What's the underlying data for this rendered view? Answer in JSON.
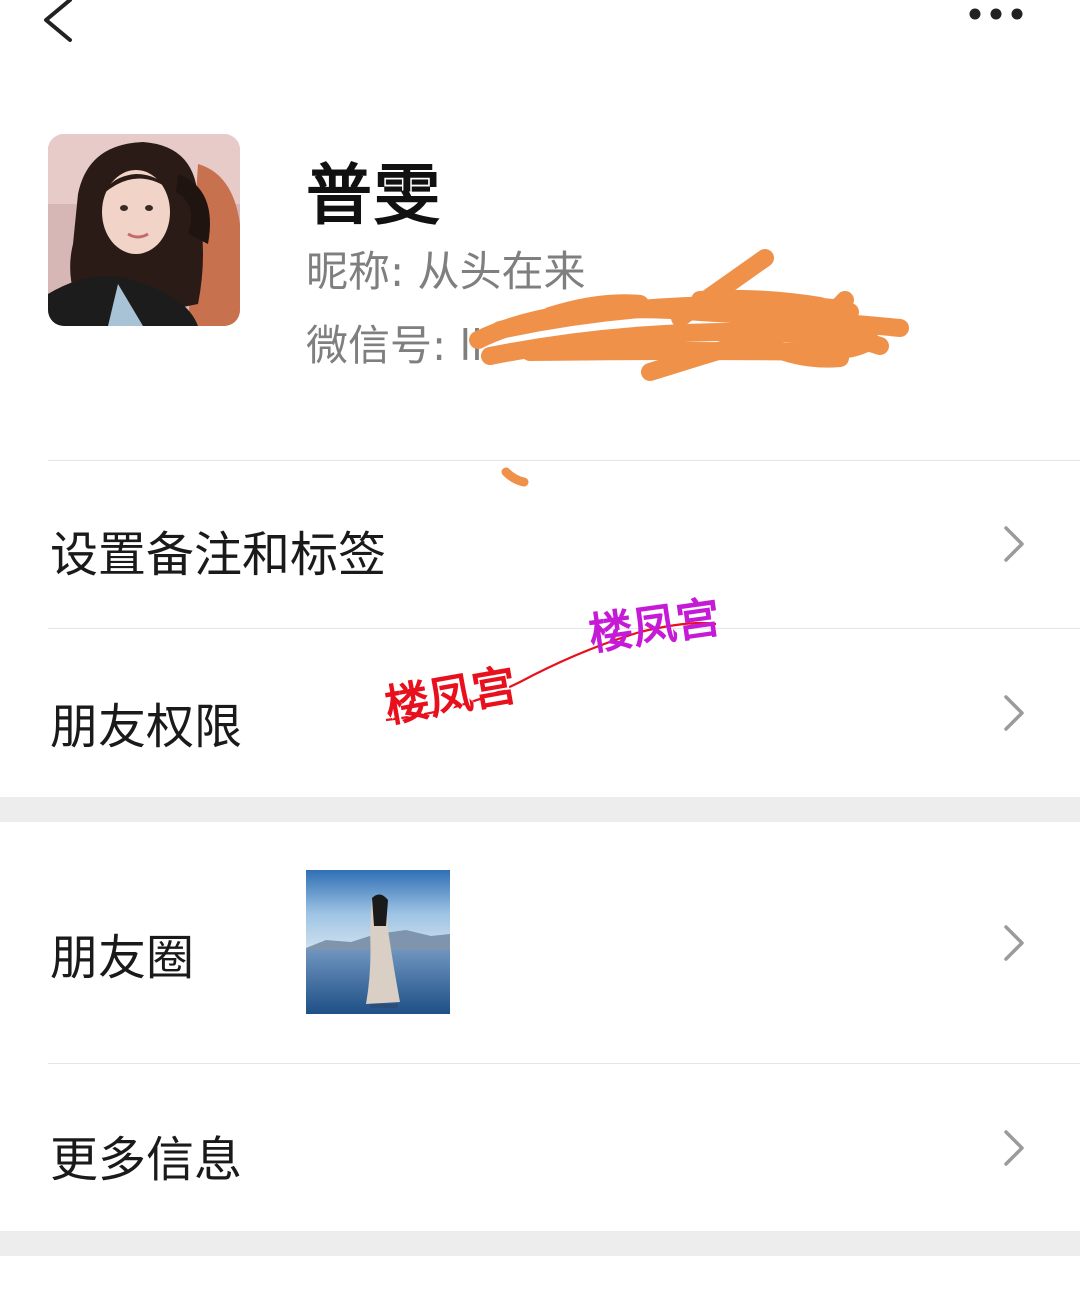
{
  "topbar": {
    "back_icon": "chevron-left-icon",
    "more_icon": "more-dots-icon"
  },
  "profile": {
    "name": "普雯",
    "nickname": "昵称:  从头在来",
    "wechat_id": "微信号:  li",
    "avatar_icon": "avatar-photo"
  },
  "rows": {
    "remark": "设置备注和标签",
    "permissions": "朋友权限",
    "moments": "朋友圈",
    "more_info": "更多信息"
  },
  "watermark": {
    "text": "楼凤宫"
  },
  "colors": {
    "scribble": "#f0914a",
    "watermark_red": "#e8101c",
    "watermark_purple": "#c61bd6",
    "section_gap": "#ededed"
  }
}
